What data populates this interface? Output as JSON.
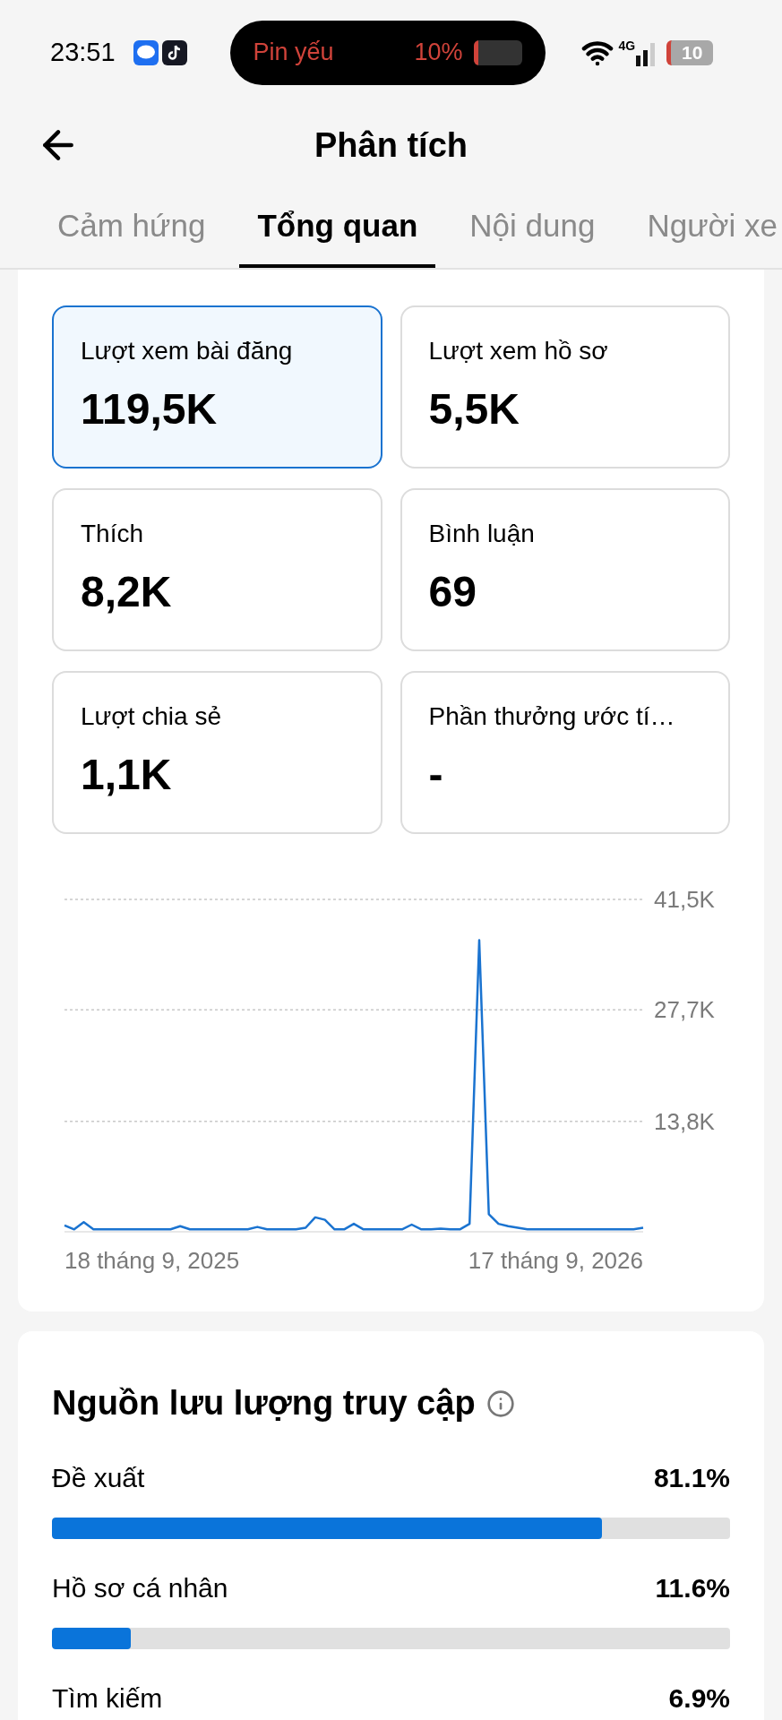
{
  "status_bar": {
    "time": "23:51",
    "alert": {
      "label": "Pin yếu",
      "percent": "10%",
      "level": 0.1
    },
    "network": "4G",
    "battery": "10"
  },
  "header": {
    "title": "Phân tích"
  },
  "tabs": [
    {
      "label": "Cảm hứng",
      "selected": false
    },
    {
      "label": "Tổng quan",
      "selected": true
    },
    {
      "label": "Nội dung",
      "selected": false
    },
    {
      "label": "Người xe",
      "selected": false
    }
  ],
  "metrics": [
    {
      "label": "Lượt xem bài đăng",
      "value": "119,5K",
      "selected": true
    },
    {
      "label": "Lượt xem hồ sơ",
      "value": "5,5K",
      "selected": false
    },
    {
      "label": "Thích",
      "value": "8,2K",
      "selected": false
    },
    {
      "label": "Bình luận",
      "value": "69",
      "selected": false
    },
    {
      "label": "Lượt chia sẻ",
      "value": "1,1K",
      "selected": false
    },
    {
      "label": "Phần thưởng ước tí…",
      "value": "-",
      "selected": false
    }
  ],
  "chart_dates": [
    "18 tháng 9, 2025",
    "17 tháng 9, 2026"
  ],
  "chart_data": {
    "type": "line",
    "ylim": [
      0,
      41500
    ],
    "yticks": [
      {
        "value": 13800,
        "label": "13,8K"
      },
      {
        "value": 27700,
        "label": "27,7K"
      },
      {
        "value": 41500,
        "label": "41,5K"
      }
    ],
    "series": [
      {
        "color": "#1a73d0",
        "values": [
          800,
          300,
          1200,
          300,
          300,
          300,
          300,
          300,
          300,
          300,
          300,
          300,
          700,
          300,
          300,
          300,
          300,
          300,
          300,
          300,
          600,
          300,
          300,
          300,
          300,
          500,
          1800,
          1500,
          300,
          300,
          1000,
          300,
          300,
          300,
          300,
          300,
          900,
          300,
          300,
          400,
          300,
          300,
          1000,
          36400,
          2200,
          1000,
          700,
          500,
          300,
          300,
          300,
          300,
          300,
          300,
          300,
          300,
          300,
          300,
          300,
          300,
          500
        ]
      }
    ]
  },
  "traffic": {
    "title": "Nguồn lưu lượng truy cập",
    "sources": [
      {
        "label": "Đề xuất",
        "percent": "81.1%",
        "level": 0.811
      },
      {
        "label": "Hồ sơ cá nhân",
        "percent": "11.6%",
        "level": 0.116
      },
      {
        "label": "Tìm kiếm",
        "percent": "6.9%"
      }
    ]
  }
}
